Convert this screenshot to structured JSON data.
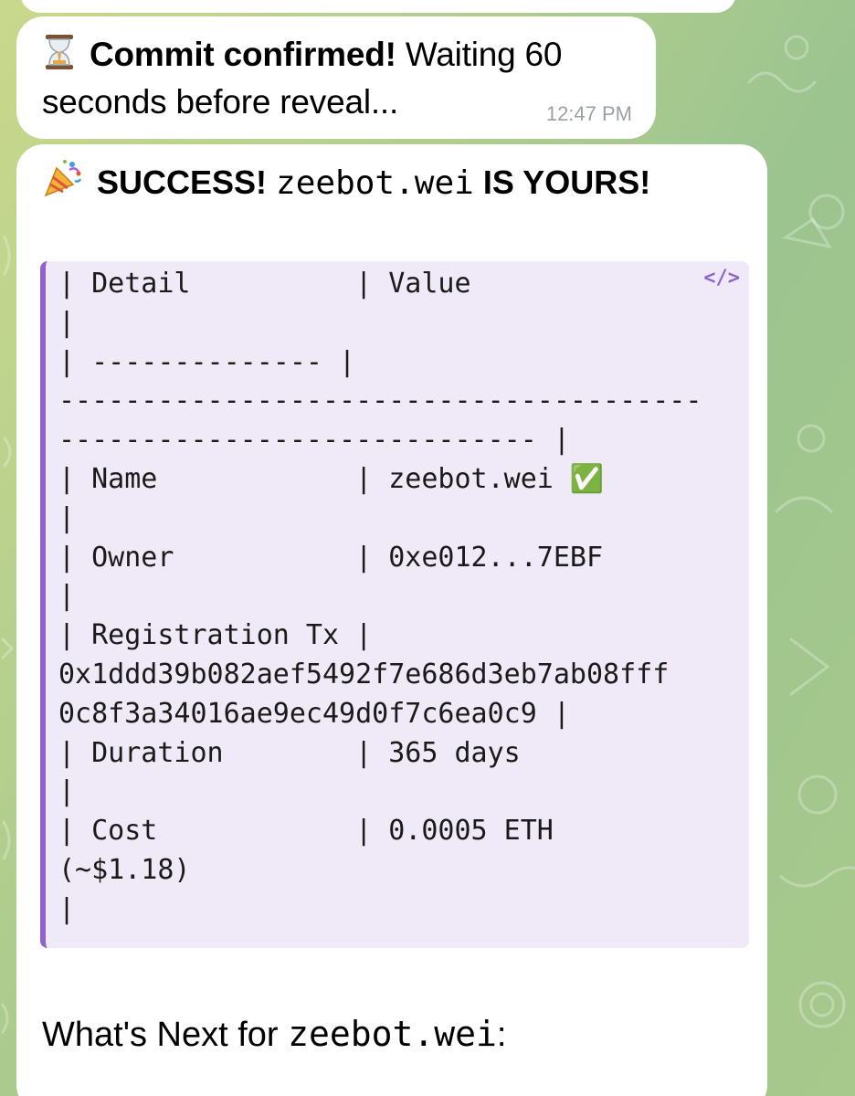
{
  "messages": {
    "commit": {
      "emoji": "hourglass",
      "bold_text": "Commit confirmed!",
      "text_line1": "Waiting 60",
      "text_line2": "seconds before reveal...",
      "time": "12:47 PM"
    },
    "success": {
      "emoji": "party-popper",
      "prefix": "SUCCESS!",
      "name": "zeebot.wei",
      "suffix": "IS YOURS!",
      "code_block": {
        "icon": "</>",
        "lines": [
          "| Detail          | Value",
          "|",
          "| -------------- |",
          "---------------------------------------",
          "----------------------------- |",
          "| Name            | zeebot.wei ✅",
          "|",
          "| Owner           | 0xe012...7EBF",
          "|",
          "| Registration Tx |",
          "0x1ddd39b082aef5492f7e686d3eb7ab08fff",
          "0c8f3a34016ae9ec49d0f7c6ea0c9 |",
          "| Duration        | 365 days",
          "|",
          "| Cost            | 0.0005 ETH",
          "(~$1.18)",
          "|"
        ]
      },
      "next_prefix": "What's Next for",
      "next_name": "zeebot.wei",
      "next_suffix": ":"
    }
  },
  "colors": {
    "accent": "#8f63cf",
    "code_background": "#f0eaf8",
    "bubble": "#ffffff",
    "timestamp": "#9aa0a6"
  }
}
